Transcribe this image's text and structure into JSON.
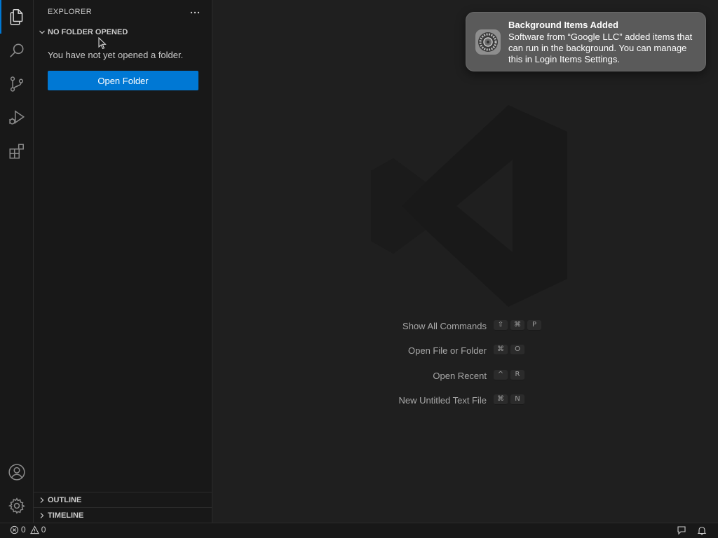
{
  "sidebar": {
    "title": "EXPLORER",
    "more_actions_icon": "ellipsis-icon",
    "no_folder_section": "NO FOLDER OPENED",
    "empty_message": "You have not yet opened a folder.",
    "open_folder_label": "Open Folder",
    "outline_section": "OUTLINE",
    "timeline_section": "TIMELINE"
  },
  "activity_bar": {
    "items": [
      "explorer-icon",
      "search-icon",
      "source-control-icon",
      "run-debug-icon",
      "extensions-icon"
    ],
    "bottom": [
      "account-icon",
      "manage-gear-icon"
    ]
  },
  "editor": {
    "shortcuts": [
      {
        "label": "Show All Commands",
        "keys": [
          "⇧",
          "⌘",
          "P"
        ]
      },
      {
        "label": "Open File or Folder",
        "keys": [
          "⌘",
          "O"
        ]
      },
      {
        "label": "Open Recent",
        "keys": [
          "^",
          "R"
        ]
      },
      {
        "label": "New Untitled Text File",
        "keys": [
          "⌘",
          "N"
        ]
      }
    ]
  },
  "notification": {
    "title": "Background Items Added",
    "body": "Software from “Google LLC” added items that can run in the background. You can manage this in Login Items Settings.",
    "icon": "system-settings-gear-icon"
  },
  "status_bar": {
    "errors": "0",
    "warnings": "0",
    "right_icons": [
      "feedback-icon",
      "notifications-bell-icon"
    ]
  },
  "colors": {
    "accent": "#0078d4",
    "background": "#1f1f1f",
    "sidebar": "#181818"
  }
}
